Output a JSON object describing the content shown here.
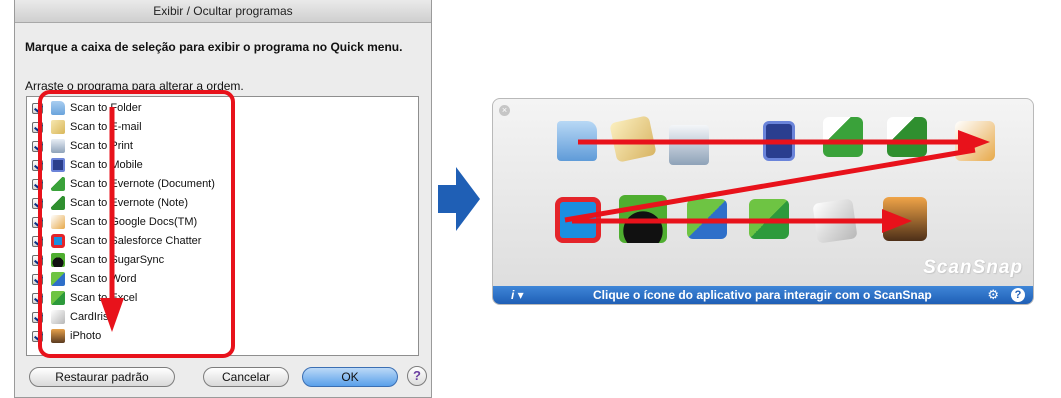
{
  "dialog": {
    "title": "Exibir / Ocultar programas",
    "instruction": "Marque a caixa de seleção para exibir o programa no Quick menu.",
    "drag_hint": "Arraste o programa para alterar a ordem.",
    "items": [
      {
        "label": "Scan to Folder",
        "icon": "folder-icon",
        "checked": true
      },
      {
        "label": "Scan to E-mail",
        "icon": "email-icon",
        "checked": true
      },
      {
        "label": "Scan to Print",
        "icon": "printer-icon",
        "checked": true
      },
      {
        "label": "Scan to Mobile",
        "icon": "mobile-icon",
        "checked": true
      },
      {
        "label": "Scan to Evernote (Document)",
        "icon": "evernote-document-icon",
        "checked": true
      },
      {
        "label": "Scan to Evernote (Note)",
        "icon": "evernote-note-icon",
        "checked": true
      },
      {
        "label": "Scan to Google Docs(TM)",
        "icon": "google-docs-icon",
        "checked": true
      },
      {
        "label": "Scan to Salesforce Chatter",
        "icon": "salesforce-chatter-icon",
        "checked": true
      },
      {
        "label": "Scan to SugarSync",
        "icon": "sugarsync-icon",
        "checked": true
      },
      {
        "label": "Scan to Word",
        "icon": "word-icon",
        "checked": true
      },
      {
        "label": "Scan to Excel",
        "icon": "excel-icon",
        "checked": true
      },
      {
        "label": "CardIris",
        "icon": "cardiris-icon",
        "checked": true
      },
      {
        "label": "iPhoto",
        "icon": "iphoto-icon",
        "checked": true
      }
    ],
    "buttons": {
      "restore": "Restaurar padrão",
      "cancel": "Cancelar",
      "ok": "OK",
      "help": "?"
    }
  },
  "quick_menu": {
    "close": "×",
    "brand": "ScanSnap",
    "info": "i ▾",
    "message": "Clique o ícone do aplicativo para interagir com o ScanSnap",
    "help": "?",
    "row1_apps": [
      "folder-icon",
      "email-icon",
      "printer-icon",
      "mobile-icon",
      "evernote-document-icon",
      "evernote-note-icon",
      "google-docs-icon"
    ],
    "row2_apps": [
      "salesforce-chatter-icon",
      "sugarsync-icon",
      "word-icon",
      "excel-icon",
      "cardiris-icon",
      "iphoto-icon"
    ]
  },
  "colors": {
    "annotation": "#e8121b",
    "arrow": "#1f5fb5",
    "bar": "#1f5fb5"
  }
}
